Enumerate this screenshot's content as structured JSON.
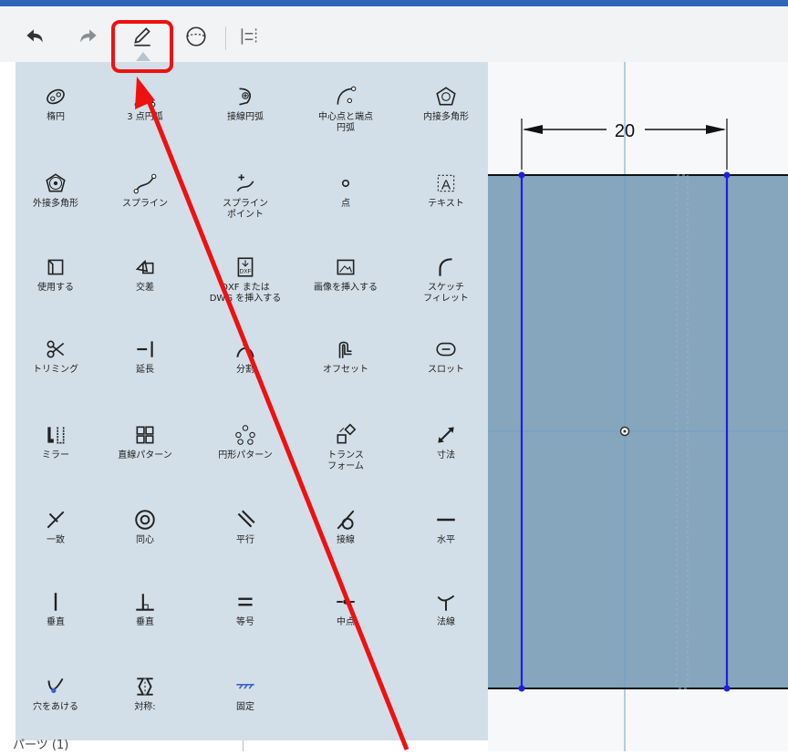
{
  "toolbar": {
    "icons": [
      "undo-icon",
      "redo-icon",
      "pencil-icon",
      "sphere-icon",
      "list-icon"
    ]
  },
  "tools": [
    {
      "label": "楕円",
      "icon": "ellipse-icon"
    },
    {
      "label": "3 点円弧",
      "icon": "three-point-arc-icon"
    },
    {
      "label": "接線円弧",
      "icon": "tangent-arc-icon"
    },
    {
      "label": "中心点と端点\n円弧",
      "icon": "center-arc-icon"
    },
    {
      "label": "内接多角形",
      "icon": "inscribed-polygon-icon"
    },
    {
      "label": "外接多角形",
      "icon": "circumscribed-polygon-icon"
    },
    {
      "label": "スプライン",
      "icon": "spline-icon"
    },
    {
      "label": "スプライン\nポイント",
      "icon": "spline-point-icon"
    },
    {
      "label": "点",
      "icon": "point-icon"
    },
    {
      "label": "テキスト",
      "icon": "text-icon"
    },
    {
      "label": "使用する",
      "icon": "use-icon"
    },
    {
      "label": "交差",
      "icon": "intersect-icon"
    },
    {
      "label": "DXF または\nDWG を挿入する",
      "icon": "dxf-icon"
    },
    {
      "label": "画像を挿入する",
      "icon": "image-icon"
    },
    {
      "label": "スケッチ\nフィレット",
      "icon": "fillet-icon"
    },
    {
      "label": "トリミング",
      "icon": "trim-icon"
    },
    {
      "label": "延長",
      "icon": "extend-icon"
    },
    {
      "label": "分割",
      "icon": "split-icon"
    },
    {
      "label": "オフセット",
      "icon": "offset-icon"
    },
    {
      "label": "スロット",
      "icon": "slot-icon"
    },
    {
      "label": "ミラー",
      "icon": "mirror-icon"
    },
    {
      "label": "直線パターン",
      "icon": "linear-pattern-icon"
    },
    {
      "label": "円形パターン",
      "icon": "circular-pattern-icon"
    },
    {
      "label": "トランス\nフォーム",
      "icon": "transform-icon"
    },
    {
      "label": "寸法",
      "icon": "dimension-icon"
    },
    {
      "label": "一致",
      "icon": "coincident-icon"
    },
    {
      "label": "同心",
      "icon": "concentric-icon"
    },
    {
      "label": "平行",
      "icon": "parallel-icon"
    },
    {
      "label": "接線",
      "icon": "tangent-icon"
    },
    {
      "label": "水平",
      "icon": "horizontal-icon"
    },
    {
      "label": "垂直",
      "icon": "vertical-icon"
    },
    {
      "label": "垂直",
      "icon": "perpendicular-icon"
    },
    {
      "label": "等号",
      "icon": "equal-icon"
    },
    {
      "label": "中点",
      "icon": "midpoint-icon"
    },
    {
      "label": "法線",
      "icon": "normal-icon"
    },
    {
      "label": "穴をあける",
      "icon": "pierce-icon"
    },
    {
      "label": "対称:",
      "icon": "symmetric-icon"
    },
    {
      "label": "固定",
      "icon": "fix-icon"
    }
  ],
  "canvas": {
    "dimension": "20",
    "colors": {
      "fill": "#85a6bc",
      "edge": "#1f1fe0",
      "construction": "#6f9fc9"
    }
  },
  "bottom": {
    "parts_label": "パーツ (1)"
  },
  "annotation": {
    "color": "#ee1111"
  }
}
